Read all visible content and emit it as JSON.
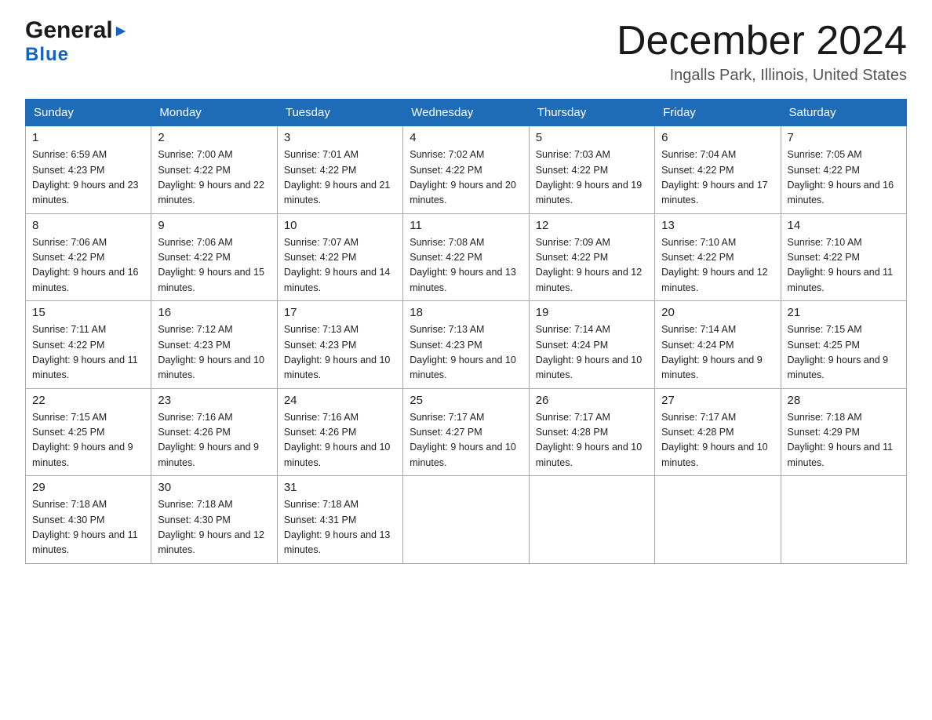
{
  "header": {
    "logo_general": "General",
    "logo_blue": "Blue",
    "month_title": "December 2024",
    "location": "Ingalls Park, Illinois, United States"
  },
  "weekdays": [
    "Sunday",
    "Monday",
    "Tuesday",
    "Wednesday",
    "Thursday",
    "Friday",
    "Saturday"
  ],
  "weeks": [
    [
      {
        "day": "1",
        "sunrise": "6:59 AM",
        "sunset": "4:23 PM",
        "daylight": "9 hours and 23 minutes."
      },
      {
        "day": "2",
        "sunrise": "7:00 AM",
        "sunset": "4:22 PM",
        "daylight": "9 hours and 22 minutes."
      },
      {
        "day": "3",
        "sunrise": "7:01 AM",
        "sunset": "4:22 PM",
        "daylight": "9 hours and 21 minutes."
      },
      {
        "day": "4",
        "sunrise": "7:02 AM",
        "sunset": "4:22 PM",
        "daylight": "9 hours and 20 minutes."
      },
      {
        "day": "5",
        "sunrise": "7:03 AM",
        "sunset": "4:22 PM",
        "daylight": "9 hours and 19 minutes."
      },
      {
        "day": "6",
        "sunrise": "7:04 AM",
        "sunset": "4:22 PM",
        "daylight": "9 hours and 17 minutes."
      },
      {
        "day": "7",
        "sunrise": "7:05 AM",
        "sunset": "4:22 PM",
        "daylight": "9 hours and 16 minutes."
      }
    ],
    [
      {
        "day": "8",
        "sunrise": "7:06 AM",
        "sunset": "4:22 PM",
        "daylight": "9 hours and 16 minutes."
      },
      {
        "day": "9",
        "sunrise": "7:06 AM",
        "sunset": "4:22 PM",
        "daylight": "9 hours and 15 minutes."
      },
      {
        "day": "10",
        "sunrise": "7:07 AM",
        "sunset": "4:22 PM",
        "daylight": "9 hours and 14 minutes."
      },
      {
        "day": "11",
        "sunrise": "7:08 AM",
        "sunset": "4:22 PM",
        "daylight": "9 hours and 13 minutes."
      },
      {
        "day": "12",
        "sunrise": "7:09 AM",
        "sunset": "4:22 PM",
        "daylight": "9 hours and 12 minutes."
      },
      {
        "day": "13",
        "sunrise": "7:10 AM",
        "sunset": "4:22 PM",
        "daylight": "9 hours and 12 minutes."
      },
      {
        "day": "14",
        "sunrise": "7:10 AM",
        "sunset": "4:22 PM",
        "daylight": "9 hours and 11 minutes."
      }
    ],
    [
      {
        "day": "15",
        "sunrise": "7:11 AM",
        "sunset": "4:22 PM",
        "daylight": "9 hours and 11 minutes."
      },
      {
        "day": "16",
        "sunrise": "7:12 AM",
        "sunset": "4:23 PM",
        "daylight": "9 hours and 10 minutes."
      },
      {
        "day": "17",
        "sunrise": "7:13 AM",
        "sunset": "4:23 PM",
        "daylight": "9 hours and 10 minutes."
      },
      {
        "day": "18",
        "sunrise": "7:13 AM",
        "sunset": "4:23 PM",
        "daylight": "9 hours and 10 minutes."
      },
      {
        "day": "19",
        "sunrise": "7:14 AM",
        "sunset": "4:24 PM",
        "daylight": "9 hours and 10 minutes."
      },
      {
        "day": "20",
        "sunrise": "7:14 AM",
        "sunset": "4:24 PM",
        "daylight": "9 hours and 9 minutes."
      },
      {
        "day": "21",
        "sunrise": "7:15 AM",
        "sunset": "4:25 PM",
        "daylight": "9 hours and 9 minutes."
      }
    ],
    [
      {
        "day": "22",
        "sunrise": "7:15 AM",
        "sunset": "4:25 PM",
        "daylight": "9 hours and 9 minutes."
      },
      {
        "day": "23",
        "sunrise": "7:16 AM",
        "sunset": "4:26 PM",
        "daylight": "9 hours and 9 minutes."
      },
      {
        "day": "24",
        "sunrise": "7:16 AM",
        "sunset": "4:26 PM",
        "daylight": "9 hours and 10 minutes."
      },
      {
        "day": "25",
        "sunrise": "7:17 AM",
        "sunset": "4:27 PM",
        "daylight": "9 hours and 10 minutes."
      },
      {
        "day": "26",
        "sunrise": "7:17 AM",
        "sunset": "4:28 PM",
        "daylight": "9 hours and 10 minutes."
      },
      {
        "day": "27",
        "sunrise": "7:17 AM",
        "sunset": "4:28 PM",
        "daylight": "9 hours and 10 minutes."
      },
      {
        "day": "28",
        "sunrise": "7:18 AM",
        "sunset": "4:29 PM",
        "daylight": "9 hours and 11 minutes."
      }
    ],
    [
      {
        "day": "29",
        "sunrise": "7:18 AM",
        "sunset": "4:30 PM",
        "daylight": "9 hours and 11 minutes."
      },
      {
        "day": "30",
        "sunrise": "7:18 AM",
        "sunset": "4:30 PM",
        "daylight": "9 hours and 12 minutes."
      },
      {
        "day": "31",
        "sunrise": "7:18 AM",
        "sunset": "4:31 PM",
        "daylight": "9 hours and 13 minutes."
      },
      null,
      null,
      null,
      null
    ]
  ]
}
